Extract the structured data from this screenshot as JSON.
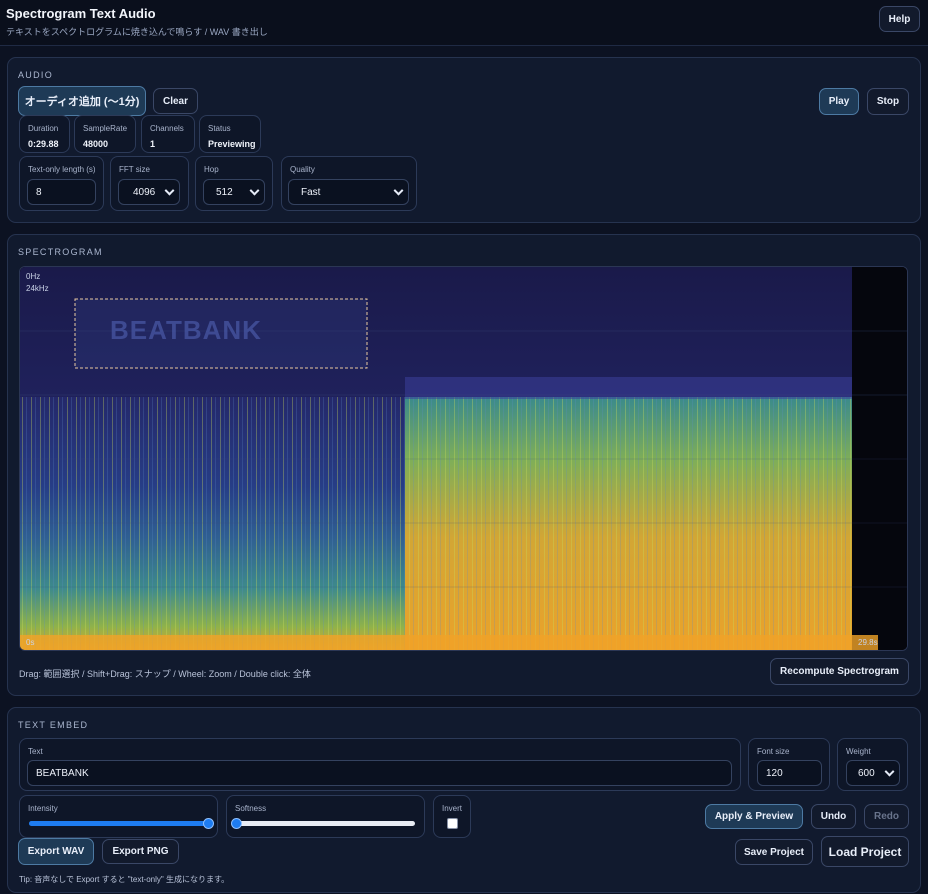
{
  "header": {
    "title": "Spectrogram Text Audio",
    "subtitle": "テキストをスペクトログラムに焼き込んで鳴らす / WAV 書き出し",
    "help_label": "Help"
  },
  "audio": {
    "section_title": "AUDIO",
    "add_label": "オーディオ追加 (〜1分)",
    "clear_label": "Clear",
    "play_label": "Play",
    "stop_label": "Stop",
    "stats": {
      "duration": {
        "label": "Duration",
        "value": "0:29.88"
      },
      "samplerate": {
        "label": "SampleRate",
        "value": "48000"
      },
      "channels": {
        "label": "Channels",
        "value": "1"
      },
      "status": {
        "label": "Status",
        "value": "Previewing"
      }
    },
    "text_only_length": {
      "label": "Text-only length (s)",
      "value": "8"
    },
    "fft_size": {
      "label": "FFT size",
      "value": "4096"
    },
    "hop": {
      "label": "Hop",
      "value": "512"
    },
    "quality": {
      "label": "Quality",
      "value": "Fast"
    }
  },
  "spectrogram": {
    "section_title": "SPECTROGRAM",
    "label_0hz": "0Hz",
    "label_24khz": "24kHz",
    "label_start": "0s",
    "label_end": "29.8s",
    "overlay_text": "BEATBANK",
    "hint": "Drag: 範囲選択 / Shift+Drag: スナップ / Wheel: Zoom / Double click: 全体",
    "recompute_label": "Recompute Spectrogram"
  },
  "text_embed": {
    "section_title": "TEXT EMBED",
    "text": {
      "label": "Text",
      "value": "BEATBANK"
    },
    "font_size": {
      "label": "Font size",
      "value": "120"
    },
    "weight": {
      "label": "Weight",
      "value": "600"
    },
    "intensity": {
      "label": "Intensity",
      "value": 1.0
    },
    "softness": {
      "label": "Softness",
      "value": 0.0
    },
    "invert": {
      "label": "Invert",
      "checked": false
    },
    "apply_label": "Apply & Preview",
    "undo_label": "Undo",
    "redo_label": "Redo",
    "export_wav_label": "Export WAV",
    "export_png_label": "Export PNG",
    "save_project_label": "Save Project",
    "load_project_label": "Load Project",
    "tip": "Tip: 音声なしで Export すると \"text-only\" 生成になります。"
  },
  "colors": {
    "accent": "#1e7cf0",
    "spectro_low": "#2a2f7a",
    "spectro_mid": "#3a8a8a",
    "spectro_high": "#e3a62b"
  }
}
